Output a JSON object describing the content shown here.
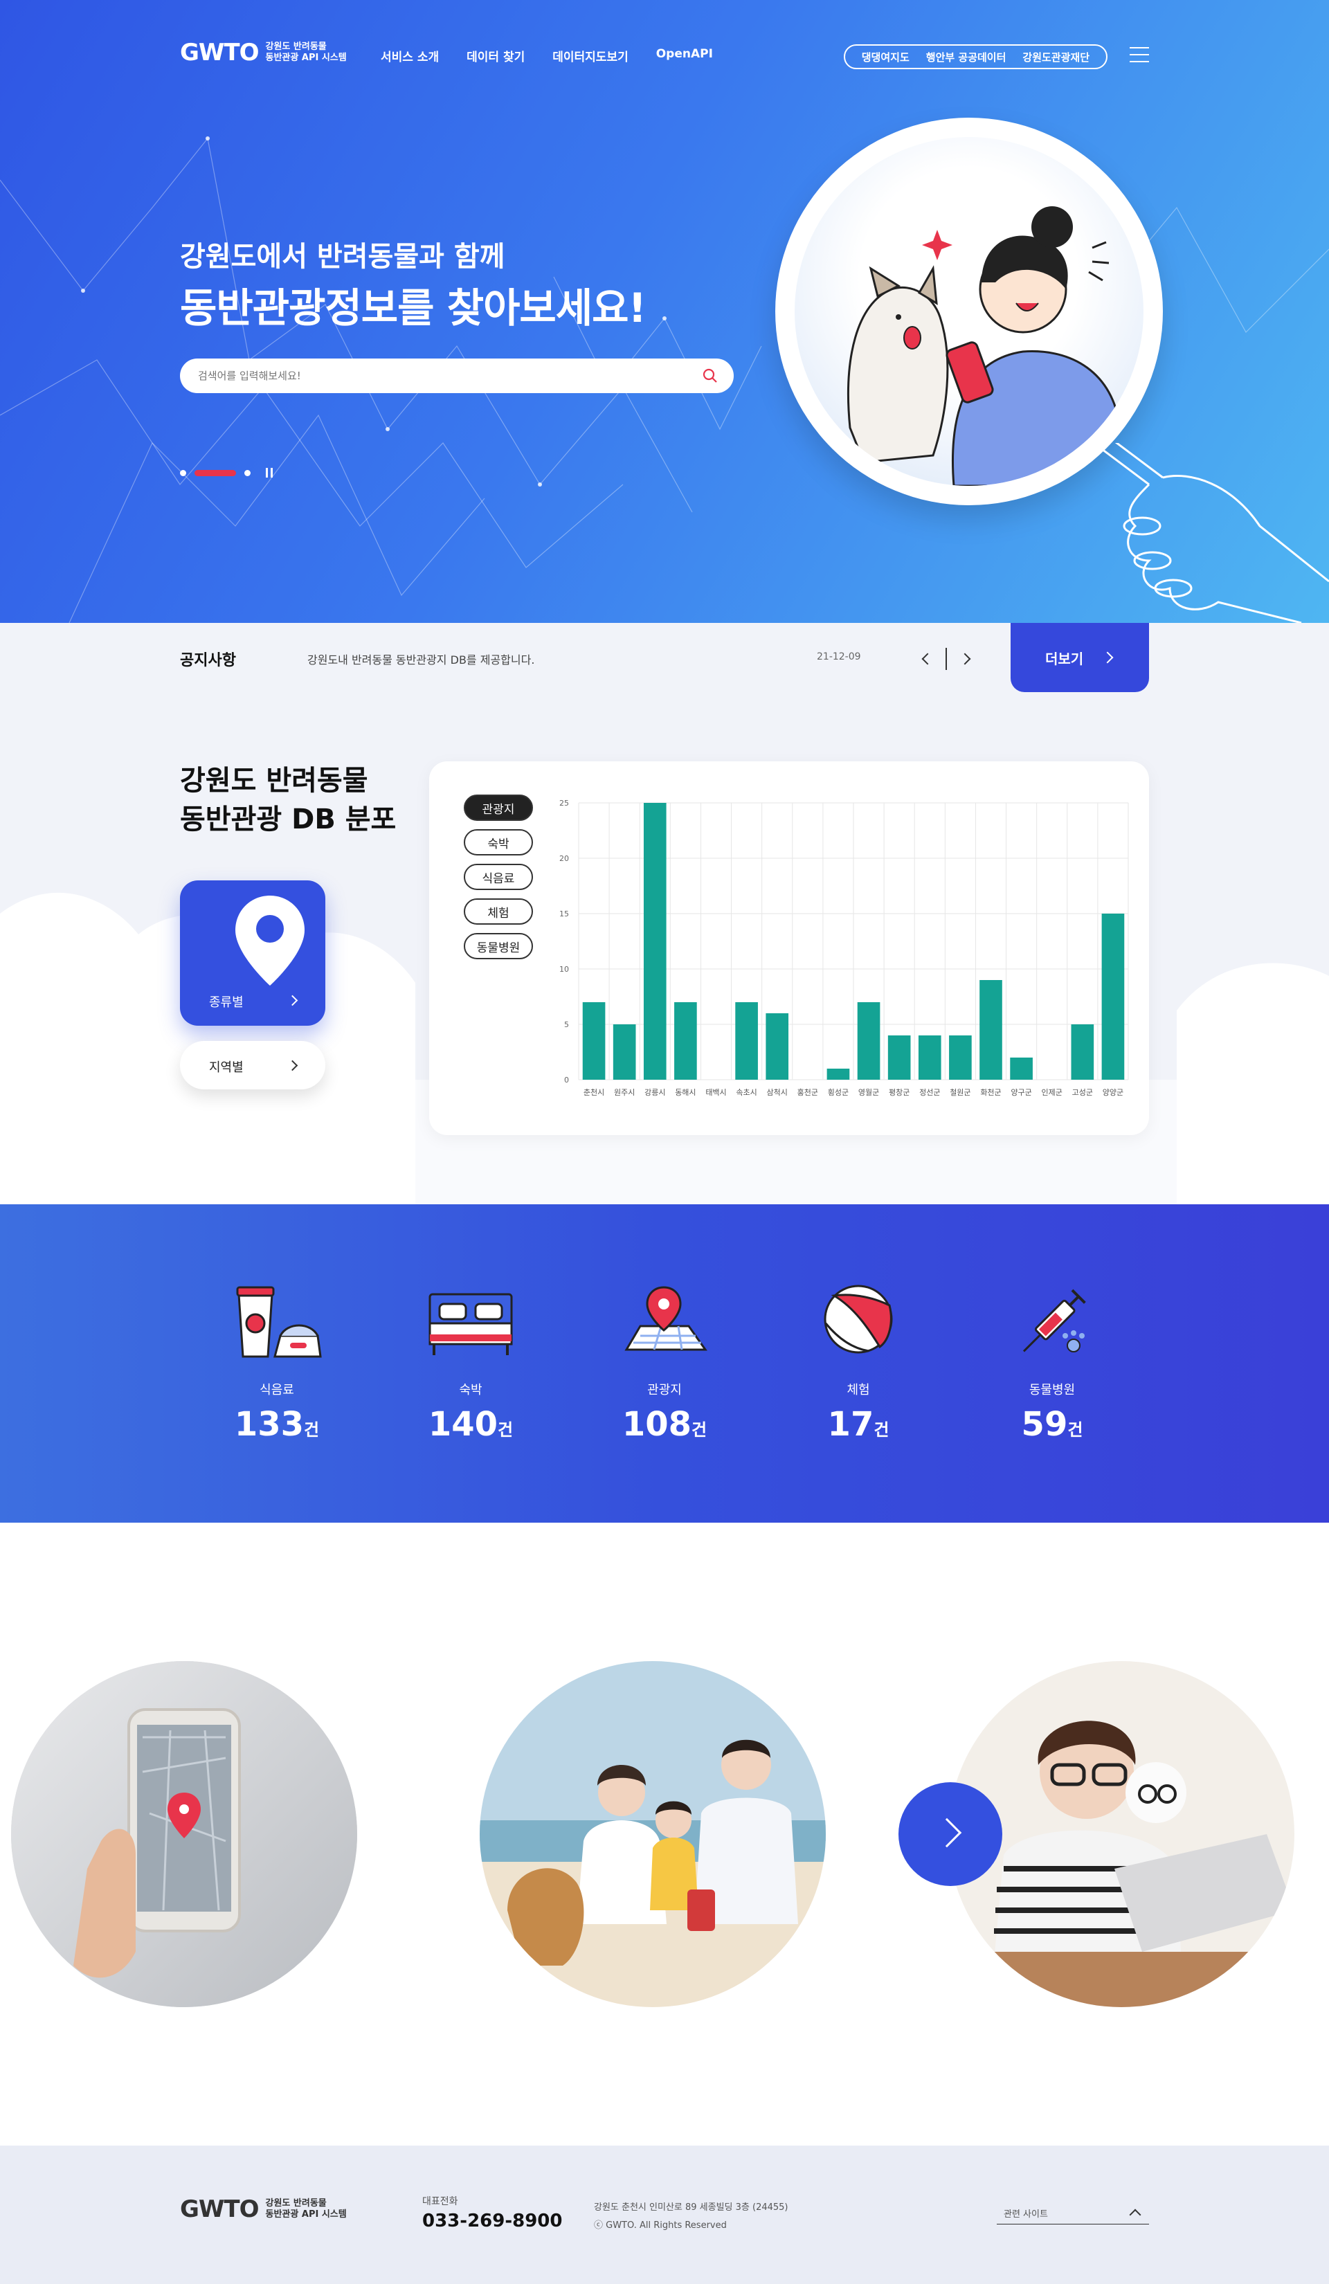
{
  "header": {
    "logo": "GWTO",
    "logo_sub1": "강원도 반려동물",
    "logo_sub2": "동반관광 API 시스템",
    "nav": [
      "서비스 소개",
      "데이터 찾기",
      "데이터지도보기",
      "OpenAPI"
    ],
    "external_links": [
      "댕댕여지도",
      "행안부 공공데이터",
      "강원도관광재단"
    ]
  },
  "hero": {
    "title1": "강원도에서 반려동물과 함께",
    "title2": "동반관광정보를 찾아보세요!",
    "search_placeholder": "검색어를 입력해보세요!"
  },
  "notice": {
    "title": "공지사항",
    "text": "강원도내 반려동물 동반관광지 DB를 제공합니다.",
    "date": "21-12-09",
    "more": "더보기"
  },
  "distribution": {
    "title1": "강원도 반려동물",
    "title2": "동반관광 DB 분포",
    "type_card": "종류별",
    "region_card": "지역별",
    "categories": [
      "관광지",
      "숙박",
      "식음료",
      "체험",
      "동물병원"
    ],
    "active_category": "관광지"
  },
  "chart_data": {
    "type": "bar",
    "categories": [
      "춘천시",
      "원주시",
      "강릉시",
      "동해시",
      "태백시",
      "속초시",
      "삼척시",
      "홍천군",
      "횡성군",
      "영월군",
      "평창군",
      "정선군",
      "철원군",
      "화천군",
      "양구군",
      "인제군",
      "고성군",
      "양양군"
    ],
    "values": [
      7,
      5,
      25,
      7,
      0,
      7,
      6,
      0,
      1,
      7,
      4,
      4,
      4,
      9,
      2,
      0,
      5,
      15
    ],
    "ylim": [
      0,
      25
    ],
    "yticks": [
      0,
      5,
      10,
      15,
      20,
      25
    ],
    "bar_color": "#14a394",
    "grid": true
  },
  "stats": [
    {
      "name": "식음료",
      "value": "133",
      "unit": "건",
      "icon": "drink-food-icon"
    },
    {
      "name": "숙박",
      "value": "140",
      "unit": "건",
      "icon": "bed-icon"
    },
    {
      "name": "관광지",
      "value": "108",
      "unit": "건",
      "icon": "map-pin-icon"
    },
    {
      "name": "체험",
      "value": "17",
      "unit": "건",
      "icon": "ball-icon"
    },
    {
      "name": "동물병원",
      "value": "59",
      "unit": "건",
      "icon": "syringe-icon"
    }
  ],
  "footer": {
    "tel_label": "대표전화",
    "tel": "033-269-8900",
    "address": "강원도 춘천시 인미산로 89 세종빌딩 3층 (24455)",
    "copyright": "ⓒ GWTO. All Rights Reserved",
    "related": "관련 사이트"
  },
  "colors": {
    "primary": "#3450df",
    "accent_red": "#e8344b",
    "bar": "#14a394"
  }
}
